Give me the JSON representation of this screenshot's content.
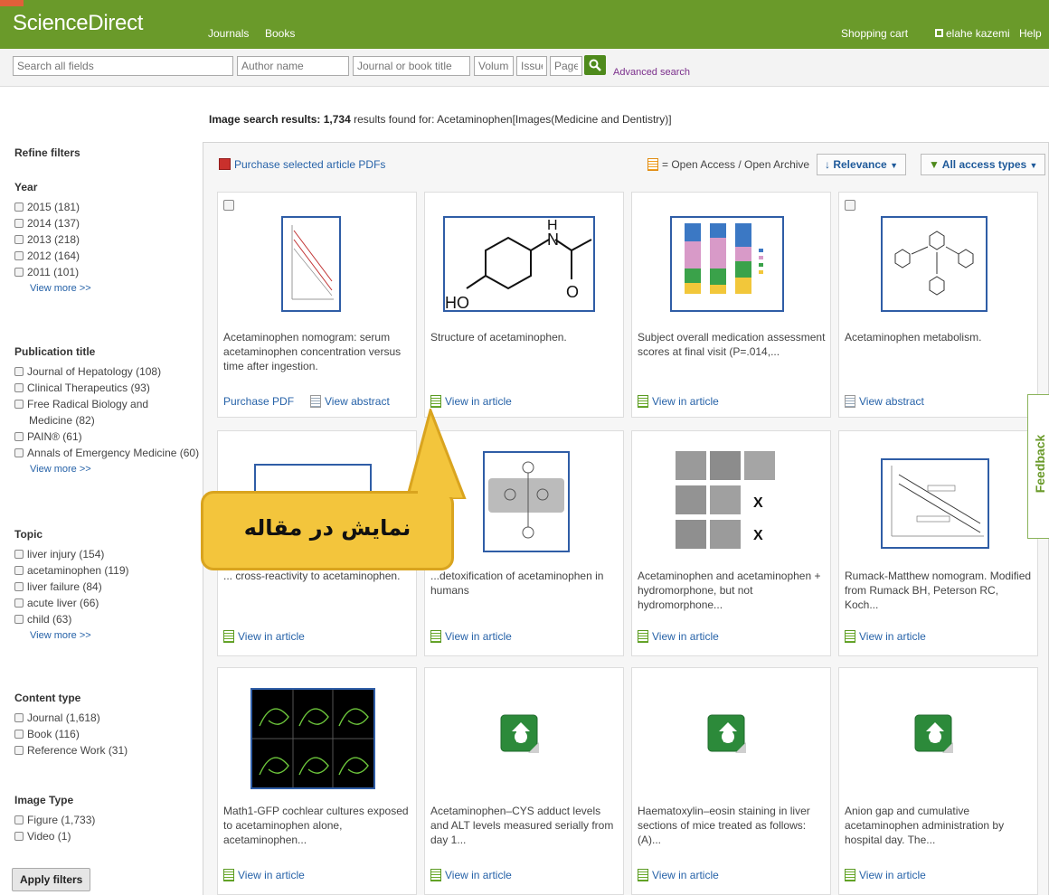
{
  "header": {
    "brand": "ScienceDirect",
    "nav": [
      "Journals",
      "Books"
    ],
    "shopping_cart": "Shopping cart",
    "user": "elahe kazemi",
    "help": "Help"
  },
  "search": {
    "all_fields_placeholder": "Search all fields",
    "author_placeholder": "Author name",
    "journal_placeholder": "Journal or book title",
    "volume_placeholder": "Volume",
    "issue_placeholder": "Issue",
    "page_placeholder": "Page",
    "advanced": "Advanced search"
  },
  "summary": {
    "prefix": "Image search results:",
    "count": "1,734",
    "suffix": "results found for: Acetaminophen[Images(Medicine and Dentistry)]"
  },
  "sidebar": {
    "refine": "Refine filters",
    "groups": [
      {
        "title": "Year",
        "items": [
          "2015 (181)",
          "2014 (137)",
          "2013 (218)",
          "2012 (164)",
          "2011 (101)"
        ],
        "more": "View more >>"
      },
      {
        "title": "Publication title",
        "items": [
          "Journal of Hepatology (108)",
          "Clinical Therapeutics (93)",
          "Free Radical Biology and",
          "Medicine (82)",
          "PAIN® (61)",
          "Annals of Emergency Medicine (60)"
        ],
        "more": "View more >>"
      },
      {
        "title": "Topic",
        "items": [
          "liver injury (154)",
          "acetaminophen (119)",
          "liver failure (84)",
          "acute liver (66)",
          "child (63)"
        ],
        "more": "View more >>"
      },
      {
        "title": "Content type",
        "items": [
          "Journal (1,618)",
          "Book (116)",
          "Reference Work (31)"
        ],
        "more": ""
      },
      {
        "title": "Image Type",
        "items": [
          "Figure (1,733)",
          "Video (1)"
        ],
        "more": ""
      }
    ],
    "apply": "Apply filters"
  },
  "toolbar": {
    "purchase": "Purchase selected article PDFs",
    "oa_legend": "= Open Access / Open Archive",
    "relevance": "Relevance",
    "access": "All access types"
  },
  "cards": [
    {
      "caption": "Acetaminophen nomogram: serum acetaminophen concentration versus time after ingestion.",
      "action": "Purchase PDF",
      "action2": "View abstract"
    },
    {
      "caption": "Structure of acetaminophen.",
      "action": "View in article",
      "action2": ""
    },
    {
      "caption": "Subject overall medication assessment scores at final visit (P=.014,...",
      "action": "View in article",
      "action2": ""
    },
    {
      "caption": "Acetaminophen metabolism.",
      "action": "View abstract",
      "action2": ""
    },
    {
      "caption": "... cross-reactivity to acetaminophen.",
      "action": "View in article",
      "action2": ""
    },
    {
      "caption": "...detoxification of acetaminophen in humans",
      "action": "View in article",
      "action2": ""
    },
    {
      "caption": "Acetaminophen and acetaminophen + hydromorphone, but not hydromorphone...",
      "action": "View in article",
      "action2": ""
    },
    {
      "caption": "Rumack-Matthew nomogram. Modified from Rumack BH, Peterson RC, Koch...",
      "action": "View in article",
      "action2": ""
    },
    {
      "caption": "Math1-GFP cochlear cultures exposed to acetaminophen alone, acetaminophen...",
      "action": "View in article",
      "action2": ""
    },
    {
      "caption": "Acetaminophen–CYS adduct levels and ALT levels measured serially from day 1...",
      "action": "View in article",
      "action2": ""
    },
    {
      "caption": "Haematoxylin–eosin staining in liver sections of mice treated as follows: (A)...",
      "action": "View in article",
      "action2": ""
    },
    {
      "caption": "Anion gap and cumulative acetaminophen administration by hospital day. The...",
      "action": "View in article",
      "action2": ""
    }
  ],
  "callout": "نمایش در مقاله",
  "feedback": "Feedback",
  "colors": {
    "brand_green": "#6a9a2a",
    "link_blue": "#2662a8",
    "callout_yellow": "#f3c53c"
  }
}
